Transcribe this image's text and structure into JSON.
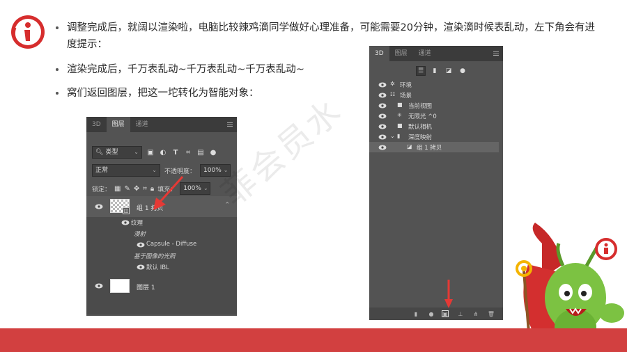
{
  "slide": {
    "bullets": [
      "调整完成后，就阔以渲染啦，电脑比较辣鸡滴同学做好心理准备，可能需要20分钟，渲染滴时候表乱动，左下角会有进度提示：",
      "渲染完成后，千万表乱动~千万表乱动~千万表乱动~",
      "窝们返回图层，把这一坨转化为智能对象："
    ],
    "watermark": "菲会员水"
  },
  "layers_panel": {
    "tabs": [
      "3D",
      "图层",
      "通道"
    ],
    "active_tab": "图层",
    "filter_label": "类型",
    "blend_mode": "正常",
    "opacity_label": "不透明度：",
    "opacity_value": "100%",
    "lock_label": "锁定：",
    "fill_label": "填充：",
    "fill_value": "100%",
    "layers": [
      {
        "name": "组 1 拷贝"
      },
      {
        "name": "图层 1"
      }
    ],
    "sub_items": {
      "texture": "纹理",
      "diffuse": "漫射",
      "capsule": "Capsule - Diffuse",
      "ibl_group": "基于图像的光照",
      "default_ibl": "默认 IBL"
    }
  },
  "three_d_panel": {
    "tabs": [
      "3D",
      "图层",
      "通道"
    ],
    "active_tab": "3D",
    "scene_items": [
      {
        "label": "环境",
        "icon": "environment-icon"
      },
      {
        "label": "场景",
        "icon": "scene-icon"
      },
      {
        "label": "当前视图",
        "icon": "camera-icon"
      },
      {
        "label": "无限光 ^0",
        "icon": "light-icon"
      },
      {
        "label": "默认相机",
        "icon": "camera-icon"
      },
      {
        "label": "深度映射",
        "icon": "mesh-icon"
      },
      {
        "label": "组 1 拷贝",
        "icon": "material-icon"
      }
    ]
  },
  "colors": {
    "footer": "#d24040",
    "accent_red": "#e53935",
    "ps_panel": "#535353",
    "ps_dark": "#3b3b3b"
  }
}
